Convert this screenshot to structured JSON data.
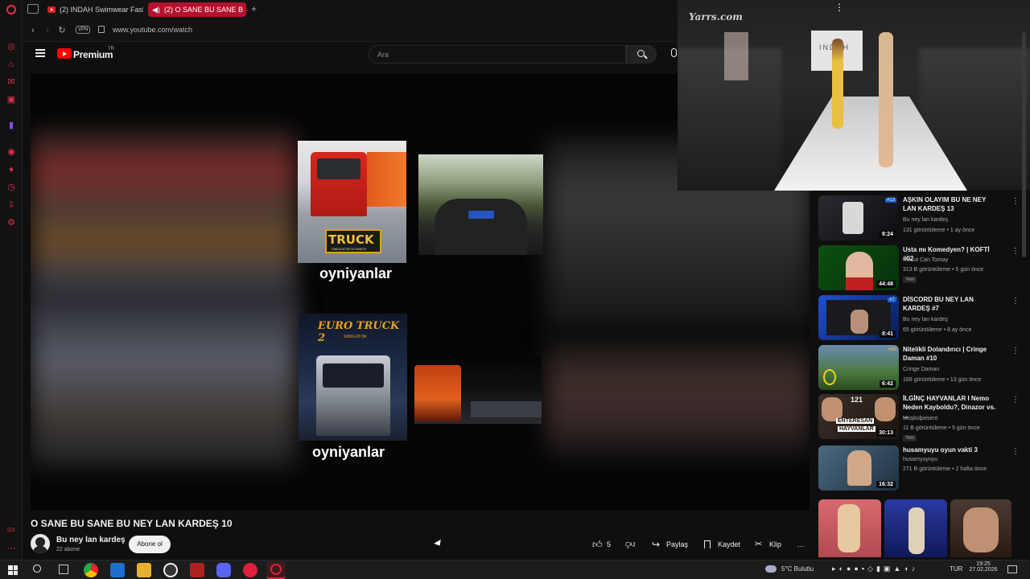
{
  "browser": {
    "tabs": [
      {
        "label": "(2) INDAH Swimwear Fash",
        "active": false
      },
      {
        "label": "(2) O SANE BU SANE B",
        "active": true
      }
    ],
    "new_tab": "+",
    "url": "www.youtube.com/watch",
    "vpn": "VPN"
  },
  "yt": {
    "logo": "Premium",
    "logo_region": "TR",
    "search_placeholder": "Ara"
  },
  "player": {
    "caption_top": "oyniyanlar",
    "caption_bottom": "oyniyanlar",
    "truck_logo_1": "TRUCK",
    "truck_logo_1_sub": "SIMULATOR ULTIMATE",
    "truck_logo_2": "EURO TRUCK 2",
    "truck_logo_2_sub": "SIMULATOR"
  },
  "mini_player": {
    "watermark": "Yarrs.com",
    "runway_sign": "INDAH"
  },
  "video": {
    "title": "O SANE BU SANE BU NEY LAN KARDEŞ 10",
    "channel": "Bu ney lan kardeş",
    "subscribers": "22 abone",
    "subscribe": "Abone ol",
    "likes": "5",
    "share": "Paylaş",
    "save": "Kaydet",
    "clip": "Klip",
    "more": "…"
  },
  "recommendations": [
    {
      "title": "AŞKIN OLAYIM BU NE NEY LAN KARDEŞ 13",
      "channel": "Bu ney lan kardeş",
      "meta": "131 görüntüleme • 1 ay önce",
      "duration": "8:24",
      "badge": "",
      "tag": "#13"
    },
    {
      "title": "Usta mı Komedyen? | KOFTİ #02",
      "channel": "Mesut Can Tomay",
      "meta": "313 B görüntüleme • 5 gün önce",
      "duration": "44:48",
      "badge": "Yeni",
      "tag": ""
    },
    {
      "title": "DİSCORD BU NEY LAN KARDEŞ #7",
      "channel": "Bu ney lan kardeş",
      "meta": "65 görüntüleme • 8 ay önce",
      "duration": "8:41",
      "badge": "",
      "tag": "#7"
    },
    {
      "title": "Nitelikli Dolandırıcı | Cringe Daman #10",
      "channel": "Cringe Daman",
      "meta": "189 görüntüleme • 13 gün önce",
      "duration": "6:42",
      "badge": "",
      "tag": "#10"
    },
    {
      "title": "İLGİNÇ HAYVANLAR I Nemo Neden Kayboldu?, Dinazor vs. ...",
      "channel": "Müşkülpesent",
      "meta": "11 B görüntüleme • 5 gün önce",
      "duration": "30:13",
      "badge": "Yeni",
      "tag": "121"
    },
    {
      "title": "husamyuyu oyun vakti 3",
      "channel": "husamyuyuyu",
      "meta": "271 B görüntüleme • 2 hafta önce",
      "duration": "16:32",
      "badge": "",
      "tag": ""
    }
  ],
  "thumb_text": {
    "enteresan": "ENTERESAN",
    "hayvanlar": "HAYVANLAR"
  },
  "taskbar": {
    "weather": "5°C Bulutlu",
    "lang": "TUR",
    "time": "19:25",
    "date": "27.02.2026"
  }
}
